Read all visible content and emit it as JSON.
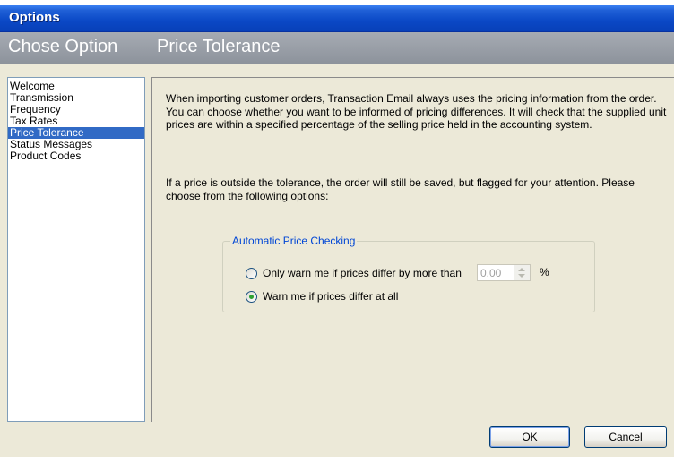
{
  "window": {
    "title": "Options"
  },
  "header": {
    "left": "Chose Option",
    "right": "Price Tolerance"
  },
  "nav": {
    "items": [
      "Welcome",
      "Transmission",
      "Frequency",
      "Tax Rates",
      "Price Tolerance",
      "Status Messages",
      "Product Codes"
    ],
    "selected": "Price Tolerance"
  },
  "content": {
    "paragraph1": "When importing customer orders, Transaction Email always uses the pricing information from the order. You can choose whether you want to be informed of pricing differences. It will check that the supplied unit prices are within a specified percentage of the selling price held in the accounting system.",
    "paragraph2": "If a price is outside the tolerance, the order will still be saved, but flagged for your attention. Please choose from the following options:",
    "group": {
      "legend": "Automatic Price Checking",
      "option1": {
        "label": "Only warn me if prices differ by more than",
        "checked": false
      },
      "spin_value": "0.00",
      "percent_symbol": "%",
      "option2": {
        "label": "Warn me if prices differ at all",
        "checked": true
      }
    }
  },
  "buttons": {
    "ok": "OK",
    "cancel": "Cancel"
  }
}
